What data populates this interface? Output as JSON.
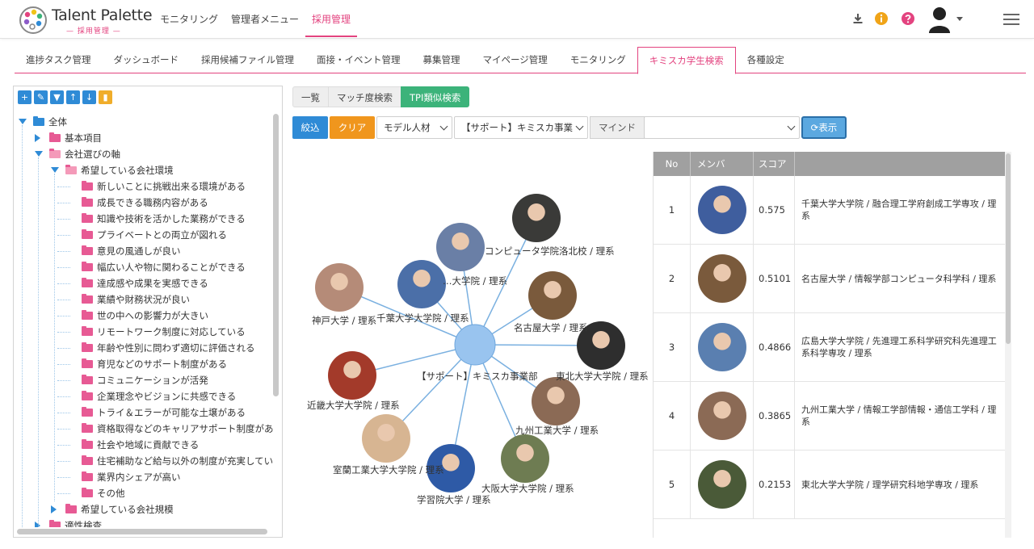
{
  "brand": {
    "name": "Talent Palette",
    "sub": "— 採用管理 —"
  },
  "topnav": [
    "モニタリング",
    "管理者メニュー",
    "採用管理"
  ],
  "subnav": [
    "進捗タスク管理",
    "ダッシュボード",
    "採用候補ファイル管理",
    "面接・イベント管理",
    "募集管理",
    "マイページ管理",
    "モニタリング",
    "キミスカ学生検索",
    "各種設定"
  ],
  "tree": {
    "toolbar_icons": [
      "plus-icon",
      "pencil-icon",
      "filter-icon",
      "arrow-up-icon",
      "arrow-down-icon",
      "trash-icon"
    ],
    "root": "全体",
    "basic": "基本項目",
    "axis": "会社選びの軸",
    "env": "希望している会社環境",
    "items": [
      "新しいことに挑戦出来る環境がある",
      "成長できる職務内容がある",
      "知識や技術を活かした業務ができる",
      "プライベートとの両立が図れる",
      "意見の風通しが良い",
      "幅広い人や物に関わることができる",
      "達成感や成果を実感できる",
      "業績や財務状況が良い",
      "世の中への影響力が大きい",
      "リモートワーク制度に対応している",
      "年齢や性別に問わず適切に評価される",
      "育児などのサポート制度がある",
      "コミュニケーションが活発",
      "企業理念やビジョンに共感できる",
      "トライ＆エラーが可能な土壌がある",
      "資格取得などのキャリアサポート制度があ",
      "社会や地域に貢献できる",
      "住宅補助など給与以外の制度が充実してい",
      "業界内シェアが高い",
      "その他"
    ],
    "scale": "希望している会社規模",
    "aptitude": "適性検査"
  },
  "search_tabs": [
    "一覧",
    "マッチ度検索",
    "TPI類似検索"
  ],
  "controls": {
    "filter": "絞込",
    "clear": "クリア",
    "model_select": "モデル人材",
    "support_select": "【サポート】キミスカ事業",
    "mind_label": "マインド",
    "mind_select": "",
    "show": "表示"
  },
  "graph": {
    "center_label": "【サポート】キミスカ事業部",
    "nodes": [
      {
        "label": "コンピュータ学院洛北校 / 理系",
        "tone": "#3a3a38"
      },
      {
        "label": "…大学院 / 理系",
        "tone": "#6a7fa6"
      },
      {
        "label": "千葉大学大学院 / 理系",
        "tone": "#4b6fa8"
      },
      {
        "label": "神戸大学 / 理系",
        "tone": "#b58b78"
      },
      {
        "label": "名古屋大学 / 理系",
        "tone": "#7a5a3c"
      },
      {
        "label": "東北大学大学院 / 理系",
        "tone": "#2e2e2e"
      },
      {
        "label": "九州工業大学 / 理系",
        "tone": "#8b6a55"
      },
      {
        "label": "近畿大学大学院 / 理系",
        "tone": "#a33a2a"
      },
      {
        "label": "室蘭工業大学大学院 / 理系",
        "tone": "#d7b592"
      },
      {
        "label": "学習院大学 / 理系",
        "tone": "#2e5aa6"
      },
      {
        "label": "大阪大学大学院 / 理系",
        "tone": "#6e7c52"
      }
    ]
  },
  "results": {
    "headers": [
      "No",
      "メンバ",
      "スコア",
      ""
    ],
    "rows": [
      {
        "no": "1",
        "score": "0.575",
        "desc": "千葉大学大学院 / 融合理工学府創成工学専攻 / 理系",
        "tone": "#3f5e9e"
      },
      {
        "no": "2",
        "score": "0.5101",
        "desc": "名古屋大学 / 情報学部コンピュータ科学科 / 理系",
        "tone": "#7a5a3c"
      },
      {
        "no": "3",
        "score": "0.4866",
        "desc": "広島大学大学院 / 先進理工系科学研究科先進理工系科学専攻 / 理系",
        "tone": "#5a7fb0"
      },
      {
        "no": "4",
        "score": "0.3865",
        "desc": "九州工業大学 / 情報工学部情報・通信工学科 / 理系",
        "tone": "#8b6a55"
      },
      {
        "no": "5",
        "score": "0.2153",
        "desc": "東北大学大学院 / 理学研究科地学専攻 / 理系",
        "tone": "#4a5a38"
      }
    ]
  }
}
